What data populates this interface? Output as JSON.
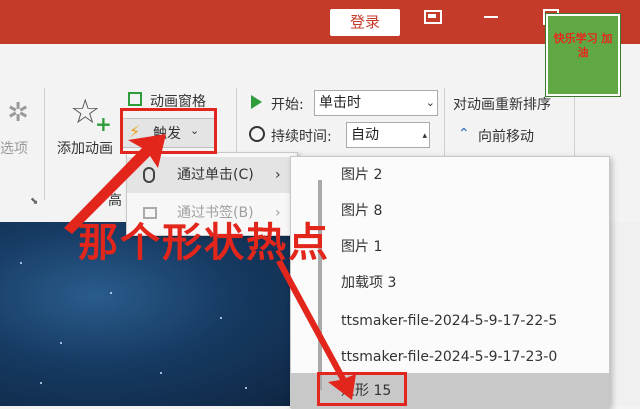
{
  "titlebar": {
    "login_label": "登录"
  },
  "ribbon": {
    "left_partial_label": "选项",
    "add_animation_label": "添加动画",
    "anim_pane_label": "动画窗格",
    "trigger_label": "触发",
    "advanced_label": "高",
    "start_label": "开始:",
    "start_value": "单击时",
    "duration_label": "持续时间:",
    "duration_value": "自动",
    "reorder_label": "对动画重新排序",
    "move_earlier_label": "向前移动"
  },
  "trigger_submenu": {
    "items": [
      {
        "label": "通过单击(C)",
        "enabled": true
      },
      {
        "label": "通过书签(B)",
        "enabled": false
      }
    ]
  },
  "shape_menu": {
    "items": [
      "图片 2",
      "图片 8",
      "图片 1",
      "加载项 3",
      "ttsmaker-file-2024-5-9-17-22-5",
      "ttsmaker-file-2024-5-9-17-23-0",
      "矩形 15"
    ],
    "selected_index": 6
  },
  "annotation": {
    "caption": "那个形状热点"
  },
  "logo": {
    "text": "快乐学习 加油"
  },
  "colors": {
    "title_red": "#c53b2a",
    "annotation_red": "#e3261c",
    "logo_green": "#5fa843"
  }
}
